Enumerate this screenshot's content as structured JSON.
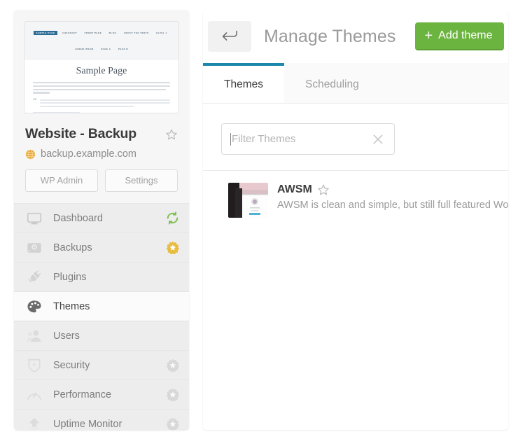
{
  "sidebar": {
    "site_thumbnail": {
      "nav_items_row1": [
        "SAMPLE PAGE",
        "CHECKOUT",
        "FRONT PAGE",
        "BLOG",
        "ABOUT THE TESTS",
        "LEVEL 1"
      ],
      "nav_items_row2": [
        "LOREM IPSUM",
        "PAGE A",
        "PAGE B"
      ],
      "current_nav_item": "SAMPLE PAGE",
      "page_title": "Sample Page"
    },
    "site_name": "Website - Backup",
    "site_url": "backup.example.com",
    "favorite_icon": "star-outline-icon",
    "globe_icon": "globe-icon",
    "buttons": [
      {
        "label": "WP Admin",
        "name": "wp-admin-button"
      },
      {
        "label": "Settings",
        "name": "site-settings-button"
      }
    ],
    "items": [
      {
        "label": "Dashboard",
        "icon": "monitor-icon",
        "badge": "refresh-icon",
        "badge_color": "#7dbf4c",
        "active": false
      },
      {
        "label": "Backups",
        "icon": "harddrive-icon",
        "badge": "sunburst-star-icon",
        "badge_color": "#e8bc3e",
        "active": false
      },
      {
        "label": "Plugins",
        "icon": "plug-icon",
        "badge": null,
        "badge_color": null,
        "active": false
      },
      {
        "label": "Themes",
        "icon": "palette-icon",
        "badge": null,
        "badge_color": null,
        "active": true
      },
      {
        "label": "Users",
        "icon": "users-icon",
        "badge": null,
        "badge_color": null,
        "active": false
      },
      {
        "label": "Security",
        "icon": "shield-icon",
        "badge": "sunburst-star-icon",
        "badge_color": "#d8d8d8",
        "active": false
      },
      {
        "label": "Performance",
        "icon": "gauge-icon",
        "badge": "sunburst-star-icon",
        "badge_color": "#d8d8d8",
        "active": false
      },
      {
        "label": "Uptime Monitor",
        "icon": "upload-icon",
        "badge": "sunburst-star-icon",
        "badge_color": "#d8d8d8",
        "active": false
      }
    ]
  },
  "main": {
    "back_icon": "back-arrow-icon",
    "title": "Manage Themes",
    "add_button": {
      "label": "Add theme",
      "plus": "+",
      "color": "#6cb440"
    },
    "tabs": [
      {
        "label": "Themes",
        "active": true
      },
      {
        "label": "Scheduling",
        "active": false
      }
    ],
    "active_tab_accent": "#1b87aa",
    "filter": {
      "placeholder": "Filter Themes",
      "value": "",
      "clear_icon": "close-x-icon"
    },
    "themes": [
      {
        "name": "AWSM",
        "favorite_icon": "star-outline-icon",
        "description": "AWSM is clean and simple, but still full featured Wor"
      }
    ]
  }
}
